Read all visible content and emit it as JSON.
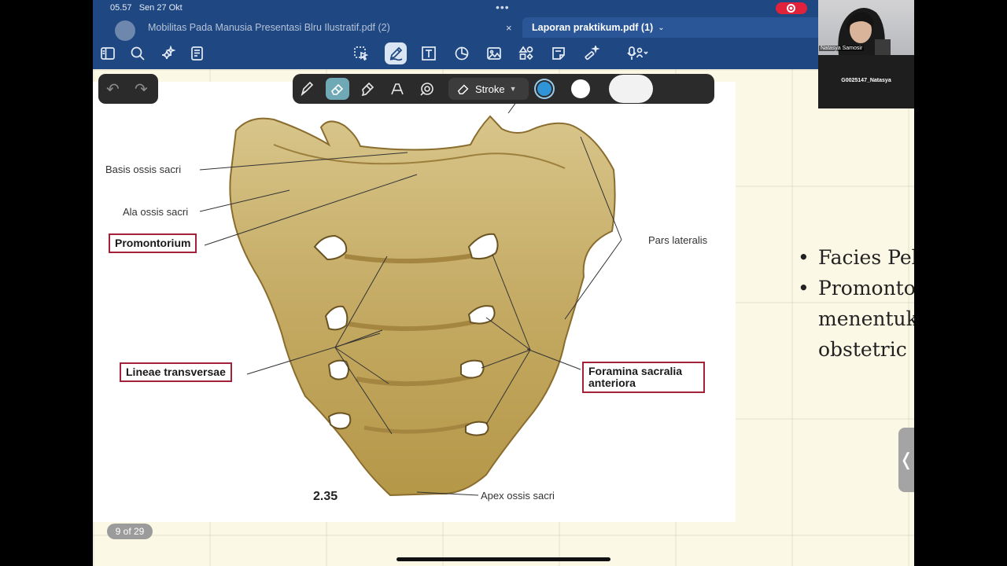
{
  "status": {
    "time": "05.57",
    "date": "Sen 27 Okt"
  },
  "tabs": [
    {
      "label": "Mobilitas Pada Manusia Presentasi Blru Ilustratif.pdf (2)",
      "close": "×"
    },
    {
      "label": "Laporan praktikum.pdf (1)",
      "chevron": "⌄"
    }
  ],
  "toolbar": {
    "left_icons": [
      "sidebar-icon",
      "search-icon",
      "ai-sparkle-icon",
      "notes-icon"
    ],
    "center_icons": [
      "select-icon",
      "pen-icon",
      "text-box-icon",
      "shape-icon",
      "image-icon",
      "elements-icon",
      "sticky-note-icon",
      "magic-wand-icon",
      "microphone-icon"
    ],
    "active": "pen-icon"
  },
  "history": {
    "undo": "↶",
    "redo": "↷"
  },
  "annotation_bar": {
    "tools": [
      "pen-icon",
      "eraser-icon",
      "highlighter-icon",
      "lasso-icon",
      "shapes-icon"
    ],
    "active": "eraser-icon",
    "stroke_label": "Stroke",
    "colors": {
      "accent": "#2f95d8",
      "white": "#ffffff"
    }
  },
  "figure": {
    "labels": {
      "basis": "Basis ossis sacri",
      "ala": "Ala ossis sacri",
      "promontorium": "Promontorium",
      "pars_lateralis": "Pars lateralis",
      "lineae": "Lineae transversae",
      "foramina_1": "Foramina sacralia",
      "foramina_2": "anteriora",
      "apex": "Apex ossis sacri"
    },
    "figure_number": "2.35",
    "box_color": "#a3223a"
  },
  "page_indicator": "9 of 29",
  "slide_text": {
    "bullet1": "Facies Pelv",
    "bullet2": "Promontor",
    "bullet2_cont1": "menentuka",
    "bullet2_cont2": "obstetric"
  },
  "side_handle": "❬",
  "video": {
    "participant1": "Natasya Samosir",
    "participant2": "G0025147_Natasya"
  }
}
